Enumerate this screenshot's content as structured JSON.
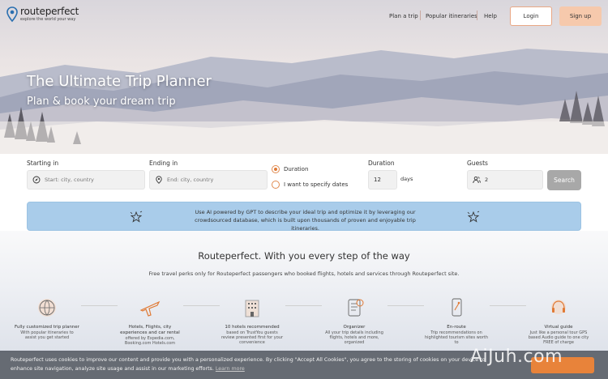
{
  "header": {
    "logo_name": "routeperfect",
    "logo_tagline": "explore the world your way",
    "nav": [
      "Plan a trip",
      "Popular itineraries",
      "Help"
    ],
    "login_label": "Login",
    "signup_label": "Sign up"
  },
  "hero": {
    "title": "The Ultimate Trip Planner",
    "subtitle": "Plan & book your dream trip"
  },
  "search": {
    "starting_label": "Starting in",
    "starting_placeholder": "Start: city, country",
    "ending_label": "Ending in",
    "ending_placeholder": "End: city, country",
    "option_duration": "Duration",
    "option_dates": "I want to specify dates",
    "selected_option": "Duration",
    "duration_label": "Duration",
    "duration_value": "12",
    "duration_unit": "days",
    "guests_label": "Guests",
    "guests_value": "2",
    "search_label": "Search"
  },
  "ai_banner": {
    "text": "Use AI powered by GPT to describe your ideal trip and optimize it by leveraging our crowdsourced database, which is built upon thousands of proven and enjoyable trip itineraries."
  },
  "features_section": {
    "title": "Routeperfect. With you every step of the way",
    "subtitle": "Free travel perks only for Routeperfect passengers who booked flights, hotels and services through Routeperfect site.",
    "items": [
      {
        "icon": "globe-pin-icon",
        "title": "Fully customized trip planner",
        "desc": "With popular itineraries to assist you get started"
      },
      {
        "icon": "airplane-icon",
        "title": "Hotels, Flights, city experiences and car rental",
        "desc": "offered by Expedia.com, Booking.com Hotels.com"
      },
      {
        "icon": "hotel-building-icon",
        "title": "10 hotels recommended",
        "desc": "based on TrustYou guests review presented first for your convenience"
      },
      {
        "icon": "organizer-checklist-icon",
        "title": "Organizer",
        "desc": "All your trip details including flights, hotels and more, organized"
      },
      {
        "icon": "phone-route-icon",
        "title": "En-route",
        "desc": "Trip recommendations on highlighted tourism sites worth to"
      },
      {
        "icon": "audio-guide-icon",
        "title": "Virtual guide",
        "desc": "Just like a personal tour GPS based Audio guide to one city FREE of charge"
      }
    ]
  },
  "cookie_bar": {
    "text": "Routeperfect uses cookies to improve our content and provide you with a personalized experience. By clicking \"Accept All Cookies\", you agree to the storing of cookies on your device to enhance site navigation, analyze site usage and assist in our marketing efforts.",
    "link": "Learn more"
  },
  "watermark": "AiJuh.com",
  "colors": {
    "accent": "#e07a35",
    "signup_bg": "#f6c9ac",
    "banner_bg": "#a9ccea",
    "search_button": "#a8a8a8"
  }
}
